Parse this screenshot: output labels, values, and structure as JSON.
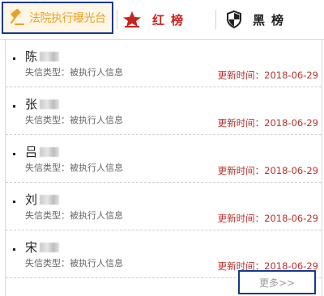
{
  "tabs": {
    "exposure": {
      "label": "法院执行曝光台",
      "icon": "gavel-icon"
    },
    "red": {
      "label": "红榜",
      "icon": "star-icon"
    },
    "black": {
      "label": "黑榜",
      "icon": "shield-icon"
    }
  },
  "list": {
    "items": [
      {
        "surname": "陈",
        "type_label": "失信类型：被执行人信息",
        "updated": "更新时间：2018-06-29"
      },
      {
        "surname": "张",
        "type_label": "失信类型：被执行人信息",
        "updated": "更新时间：2018-06-29"
      },
      {
        "surname": "吕",
        "type_label": "失信类型：被执行人信息",
        "updated": "更新时间：2018-06-29"
      },
      {
        "surname": "刘",
        "type_label": "失信类型：被执行人信息",
        "updated": "更新时间：2018-06-29"
      },
      {
        "surname": "宋",
        "type_label": "失信类型：被执行人信息",
        "updated": "更新时间：2018-06-29"
      }
    ]
  },
  "more_label": "更多>>",
  "colors": {
    "accent_border": "#123a8f",
    "exposure_text": "#e8a128",
    "red_text": "#c8231f",
    "date_text": "#b8322c"
  }
}
